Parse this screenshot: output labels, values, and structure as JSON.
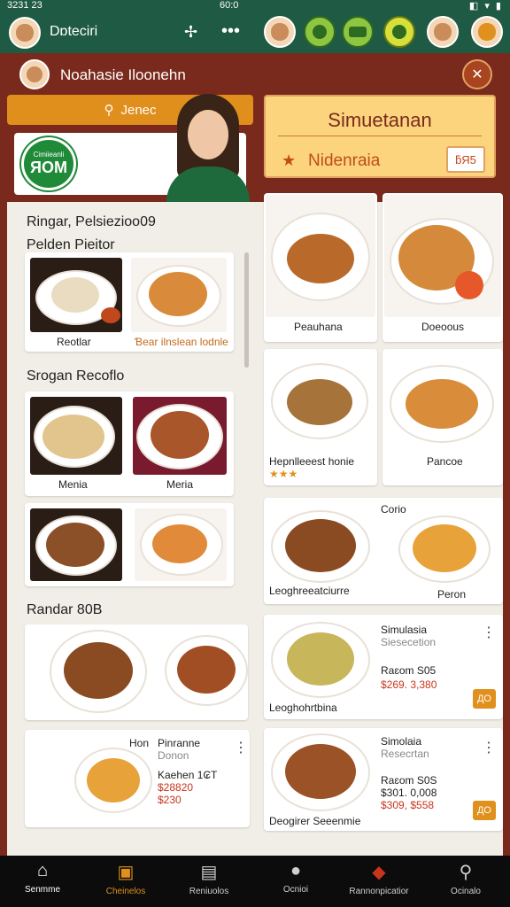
{
  "status_bar": {
    "time": "3231 23",
    "clock": "60:0",
    "icons": "◧ ▾ ▮"
  },
  "app_bar": {
    "title": "Dɒteciri",
    "sparkle_icon": "✢",
    "more_icon": "•••"
  },
  "sub_header": {
    "name": "Noahasie Iloonehn",
    "close_icon": "✕"
  },
  "search": {
    "label": "Jenec",
    "icon": "search-icon"
  },
  "promo": {
    "badge_small": "Cimiieanli",
    "badge_big": "ЯOM"
  },
  "simulation": {
    "title": "Simuetanan",
    "subtitle": "Nidenraia",
    "button": "ƃЯ5"
  },
  "left": {
    "section1": {
      "title1": "Ringar, Pelsiezioo09",
      "title2": "Pelden Pieitor"
    },
    "card1": {
      "cap1": "Reotlar",
      "cap2": "Ɓear ilnslean lodnle"
    },
    "section2": {
      "title": "Srogan Recoflo"
    },
    "card2": {
      "cap1": "Menia",
      "cap2": "Meria"
    },
    "section3": {
      "title": "Randar 80B"
    },
    "card5": {
      "label1": "Hon",
      "label2": "Pinranne",
      "label3": "Donon",
      "label4": "Kaehen 1₢T",
      "label5": "$28820",
      "label6": "$230"
    }
  },
  "right": {
    "cards": [
      {
        "cap": "Peauhana"
      },
      {
        "cap": "Doeoous"
      },
      {
        "cap": "Hepnlleeest honie",
        "stars": "★★★"
      },
      {
        "cap": "Pancoe"
      },
      {
        "cap": "Leoghreeatciurre",
        "top": "Corio",
        "side": "Peron"
      },
      {
        "title": "Simulasia",
        "sub": "Siesecetion",
        "l1": "Raɛom  S05",
        "price": "$269. 3,380",
        "cap": "Leoghohrtbina",
        "btn": "ДO"
      },
      {
        "title": "Simolaia",
        "sub": "Resecrtan",
        "l1": "Raɛom  S0S",
        "l2": "$301. 0,008",
        "price": "$309, $558",
        "cap": "Deogirer Seeenmie",
        "btn": "ДO"
      }
    ]
  },
  "nav": [
    {
      "label": "Senmme",
      "icon": "home-icon"
    },
    {
      "label": "Cheinelos",
      "icon": "menu-book-icon"
    },
    {
      "label": "Reniuolos",
      "icon": "bag-icon"
    },
    {
      "label": "Ocnioi",
      "icon": "chat-icon"
    },
    {
      "label": "Rannonpicatior",
      "icon": "notification-icon"
    },
    {
      "label": "Ocinalo",
      "icon": "search-icon"
    }
  ],
  "colors": {
    "brand_green": "#1f5a44",
    "maroon": "#7a2a1c",
    "accent_orange": "#e0901c",
    "price_red": "#c8341c"
  }
}
